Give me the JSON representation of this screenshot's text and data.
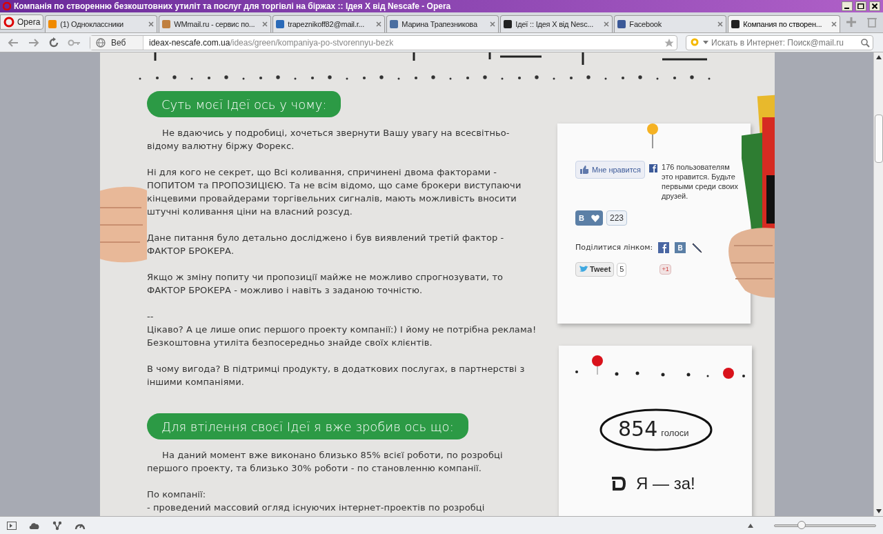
{
  "window": {
    "title": "Компанія по створенню безкоштовних утиліт та послуг для торгівлі на біржах :: Ідея X від Nescafe - Opera"
  },
  "menu_button": {
    "label": "Opera"
  },
  "tabs": [
    {
      "label": "(1) Одноклассники",
      "selected": false
    },
    {
      "label": "WMmail.ru - сервис по...",
      "selected": false
    },
    {
      "label": "trapeznikoff82@mail.r...",
      "selected": false
    },
    {
      "label": "Марина Трапезникова",
      "selected": false
    },
    {
      "label": "Ідеї :: Ідея X від Nesc...",
      "selected": false
    },
    {
      "label": "Facebook",
      "selected": false
    },
    {
      "label": "Компания по створен...",
      "selected": true
    }
  ],
  "address_bar": {
    "badge": "Веб",
    "domain": "ideax-nescafe.com.ua",
    "path": "/ideas/green/kompaniya-po-stvorennyu-bezk"
  },
  "zoom": {
    "level": 0.27
  },
  "search": {
    "placeholder": "Искать в Интернет: Поиск@mail.ru"
  },
  "sections": [
    {
      "heading": "Суть моєї Ідеї ось у чому:",
      "paragraphs": [
        {
          "text": "Не вдаючись у подробиці, хочеться звернути Вашу увагу на всесвітньо-відому валютну біржу Форекс.",
          "indent": true
        },
        {
          "text": "Ні для кого не секрет, що Всі коливання, спричинені двома факторами - ПОПИТОМ та ПРОПОЗИЦІЄЮ. Та не всім відомо, що саме брокери виступаючи кінцевими провайдерами торгівельних сигналів, мають можливість вносити штучні коливання ціни на власний розсуд.",
          "indent": false
        },
        {
          "text": "Дане питання було детально досліджено і був виявлений третій фактор - ФАКТОР БРОКЕРА.",
          "indent": false
        },
        {
          "text": "Якщо ж зміну попиту чи пропозиції майже не можливо спрогнозувати, то ФАКТОР БРОКЕРА - можливо і навіть з заданою точністю.",
          "indent": false
        },
        {
          "text": "--\nЦікаво? А це лише опис першого проекту компанії:) І йому не потрібна реклама! Безкоштовна утиліта безпосередньо знайде своїх клієнтів.",
          "indent": false
        },
        {
          "text": "В чому вигода? В підтримці продукту, в додаткових послугах, в партнерстві з іншими компаніями.",
          "indent": false
        }
      ]
    },
    {
      "heading": "Для втілення своєї Ідеї я вже зробив ось що:",
      "paragraphs": [
        {
          "text": "На даний момент вже виконано близько 85% всієї роботи, по розробці першого проекту, та близько 30% роботи - по становленню компанії.",
          "indent": true
        },
        {
          "text": "По компанії:\n- проведений массовий огляд існуючих інтернет-проектів по розробці",
          "indent": false
        }
      ]
    }
  ],
  "social": {
    "like_button": "Мне нравится",
    "like_text": "176 пользователям это нравится. Будьте первыми среди своих друзей.",
    "vk_button": "В",
    "vk_count": "223",
    "share_label": "Поділитися лінком:",
    "share_vk": "В",
    "tweet_button": "Tweet",
    "tweet_count": "5",
    "gplus_button": "+1"
  },
  "votes": {
    "count": "854",
    "unit": "голоси",
    "vote_button": "Я — за!"
  }
}
